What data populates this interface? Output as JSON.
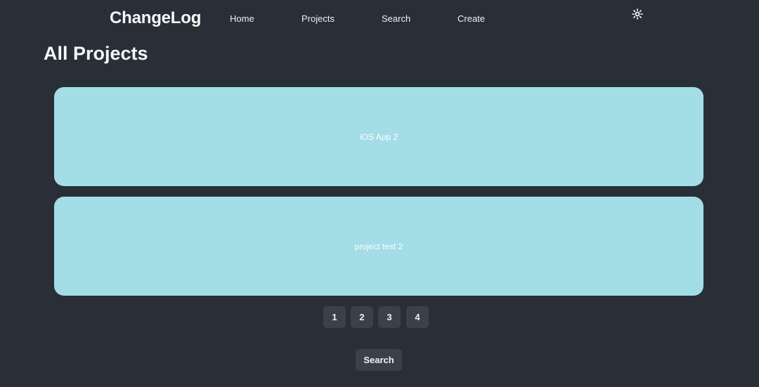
{
  "header": {
    "brand": "ChangeLog",
    "nav": [
      {
        "label": "Home"
      },
      {
        "label": "Projects"
      },
      {
        "label": "Search"
      },
      {
        "label": "Create"
      }
    ],
    "theme_toggle_icon": "sun-icon"
  },
  "main": {
    "title": "All Projects",
    "projects": [
      {
        "name": "iOS App 2"
      },
      {
        "name": "project test 2"
      }
    ],
    "pagination": [
      "1",
      "2",
      "3",
      "4"
    ],
    "search_label": "Search"
  },
  "colors": {
    "background": "#282f37",
    "card": "#a3dde6",
    "button": "#3a4149"
  }
}
